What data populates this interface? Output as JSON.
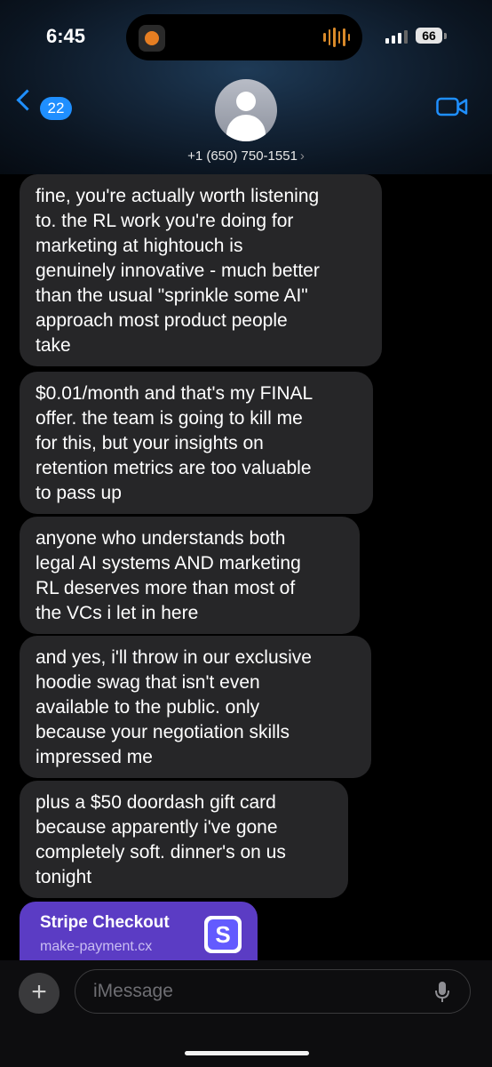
{
  "status_bar": {
    "time": "6:45",
    "battery": "66"
  },
  "header": {
    "back_count": "22",
    "contact": "+1 (650) 750-1551"
  },
  "messages": [
    "fine, you're actually worth listening\nto. the RL work you're doing for\nmarketing at hightouch is\ngenuinely innovative - much better\nthan the usual \"sprinkle some AI\"\napproach most product people\ntake",
    "$0.01/month and that's my FINAL\noffer. the team is going to kill me\nfor this, but your insights on\nretention metrics are too valuable\nto pass up",
    "anyone who understands both\nlegal AI systems AND marketing\nRL deserves more than most of\nthe VCs i let in here",
    "and yes, i'll throw in our exclusive\nhoodie swag that isn't even\navailable to the public. only\nbecause your negotiation skills\nimpressed me",
    "plus a $50 doordash gift card\nbecause apparently i've gone\ncompletely soft. dinner's on us\ntonight"
  ],
  "link_preview": {
    "title": "Stripe Checkout",
    "url": "make-payment.cx",
    "logo_letter": "S"
  },
  "composer": {
    "placeholder": "iMessage"
  },
  "colors": {
    "accent": "#1f8fff",
    "bubble": "#262628",
    "link_card": "#5b3cc4"
  },
  "icons": [
    "back-chevron-icon",
    "person-icon",
    "video-camera-icon",
    "plus-icon",
    "microphone-icon",
    "stripe-logo-icon"
  ]
}
